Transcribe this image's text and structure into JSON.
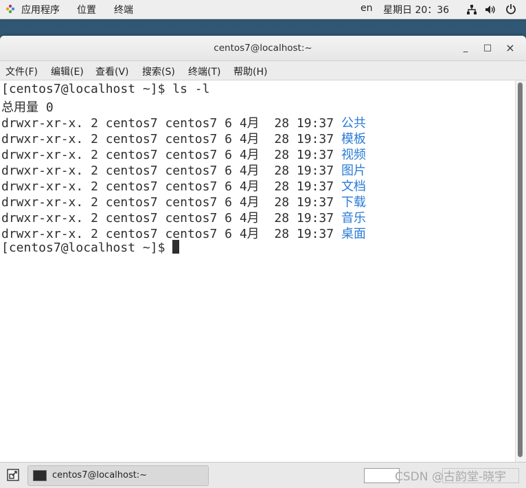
{
  "topbar": {
    "apps_label": "应用程序",
    "places_label": "位置",
    "terminal_label": "终端",
    "lang": "en",
    "clock": "星期日 20：36"
  },
  "window": {
    "title": "centos7@localhost:~",
    "minimize": "_",
    "maximize": "□",
    "close": "×"
  },
  "menu": [
    "文件(F)",
    "编辑(E)",
    "查看(V)",
    "搜索(S)",
    "终端(T)",
    "帮助(H)"
  ],
  "terminal": {
    "prompt": "[centos7@localhost ~]$ ",
    "command": "ls -l",
    "total": "总用量 0",
    "rows": [
      {
        "perm": "drwxr-xr-x.",
        "links": "2",
        "owner": "centos7",
        "group": "centos7",
        "size": "6",
        "month": "4月",
        "day": "28",
        "time": "19:37",
        "name": "公共"
      },
      {
        "perm": "drwxr-xr-x.",
        "links": "2",
        "owner": "centos7",
        "group": "centos7",
        "size": "6",
        "month": "4月",
        "day": "28",
        "time": "19:37",
        "name": "模板"
      },
      {
        "perm": "drwxr-xr-x.",
        "links": "2",
        "owner": "centos7",
        "group": "centos7",
        "size": "6",
        "month": "4月",
        "day": "28",
        "time": "19:37",
        "name": "视频"
      },
      {
        "perm": "drwxr-xr-x.",
        "links": "2",
        "owner": "centos7",
        "group": "centos7",
        "size": "6",
        "month": "4月",
        "day": "28",
        "time": "19:37",
        "name": "图片"
      },
      {
        "perm": "drwxr-xr-x.",
        "links": "2",
        "owner": "centos7",
        "group": "centos7",
        "size": "6",
        "month": "4月",
        "day": "28",
        "time": "19:37",
        "name": "文档"
      },
      {
        "perm": "drwxr-xr-x.",
        "links": "2",
        "owner": "centos7",
        "group": "centos7",
        "size": "6",
        "month": "4月",
        "day": "28",
        "time": "19:37",
        "name": "下载"
      },
      {
        "perm": "drwxr-xr-x.",
        "links": "2",
        "owner": "centos7",
        "group": "centos7",
        "size": "6",
        "month": "4月",
        "day": "28",
        "time": "19:37",
        "name": "音乐"
      },
      {
        "perm": "drwxr-xr-x.",
        "links": "2",
        "owner": "centos7",
        "group": "centos7",
        "size": "6",
        "month": "4月",
        "day": "28",
        "time": "19:37",
        "name": "桌面"
      }
    ],
    "dir_color": "#2a7bd5"
  },
  "taskbar": {
    "task_label": "centos7@localhost:~",
    "watermark": "CSDN @古韵堂-晓宇"
  }
}
